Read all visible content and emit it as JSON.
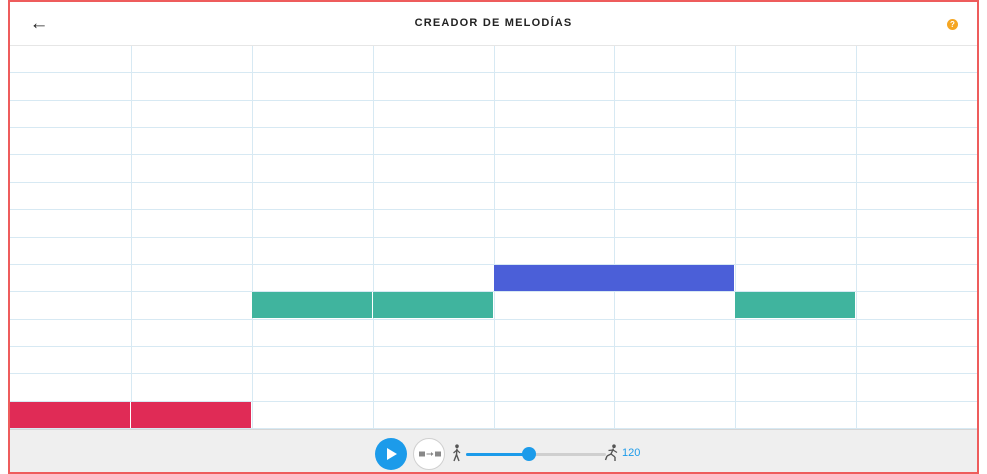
{
  "header": {
    "title": "CREADOR DE MELODÍAS",
    "back_icon": "arrow-left-icon",
    "help_icon": "question-icon",
    "help_color": "#f5a623"
  },
  "grid": {
    "columns": 8,
    "rows": 14,
    "notes": [
      {
        "row": 13,
        "col": 0,
        "color": "#e02b56"
      },
      {
        "row": 13,
        "col": 1,
        "color": "#e02b56"
      },
      {
        "row": 9,
        "col": 2,
        "color": "#40b49e"
      },
      {
        "row": 9,
        "col": 3,
        "color": "#40b49e"
      },
      {
        "row": 8,
        "col": 4,
        "color": "#4b5fd8"
      },
      {
        "row": 8,
        "col": 5,
        "color": "#4b5fd8"
      },
      {
        "row": 9,
        "col": 6,
        "color": "#40b49e"
      }
    ]
  },
  "controls": {
    "play_icon": "play-icon",
    "mode_icon": "arpeggio-icon",
    "slow_icon": "walking-person-icon",
    "fast_icon": "running-person-icon",
    "tempo_value": "120",
    "tempo_fraction": 0.45,
    "accent_color": "#1c9bea"
  }
}
